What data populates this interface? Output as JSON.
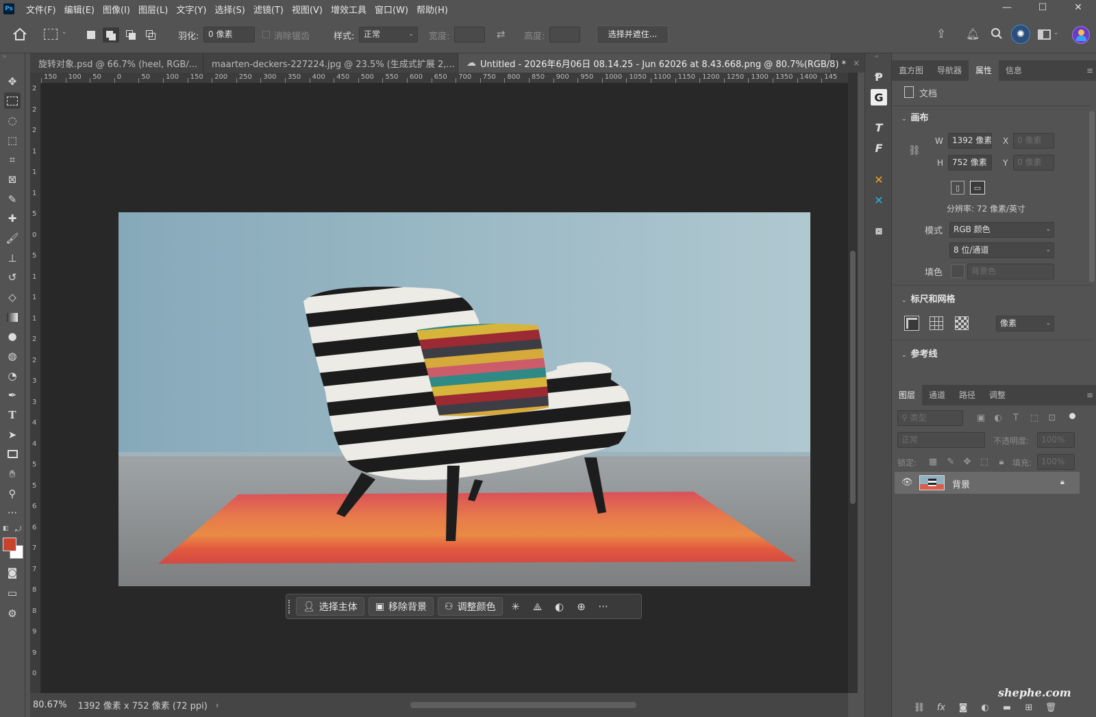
{
  "app": {
    "logo": "Ps"
  },
  "menu": [
    "文件(F)",
    "编辑(E)",
    "图像(I)",
    "图层(L)",
    "文字(Y)",
    "选择(S)",
    "滤镜(T)",
    "视图(V)",
    "增效工具",
    "窗口(W)",
    "帮助(H)"
  ],
  "window_controls": {
    "minimize": "—",
    "maximize": "☐",
    "close": "✕"
  },
  "options": {
    "feather_label": "羽化:",
    "feather_value": "0 像素",
    "antialias_label": "消除锯齿",
    "style_label": "样式:",
    "style_value": "正常",
    "width_label": "宽度:",
    "height_label": "高度:",
    "select_mask_button": "选择并遮住..."
  },
  "tabs": [
    {
      "label": "旋转对象.psd @ 66.7% (heel, RGB/...",
      "close": "×"
    },
    {
      "label": "maarten-deckers-227224.jpg @ 23.5% (生成式扩展 2,...",
      "close": "×"
    },
    {
      "label": "Untitled - 2026年6月06日 08.14.25 - Jun 62026 at 8.43.668.png @ 80.7%(RGB/8) *",
      "close": "×"
    }
  ],
  "ruler_top": [
    "150",
    "100",
    "50",
    "0",
    "50",
    "100",
    "150",
    "200",
    "250",
    "300",
    "350",
    "400",
    "450",
    "500",
    "550",
    "600",
    "650",
    "700",
    "750",
    "800",
    "850",
    "900",
    "950",
    "1000",
    "1050",
    "1100",
    "1150",
    "1200",
    "1250",
    "1300",
    "1350",
    "1400",
    "145"
  ],
  "ruler_left": [
    "2",
    "2",
    "2",
    "1",
    "1",
    "1",
    "5",
    "0",
    "5",
    "1",
    "1",
    "1",
    "2",
    "2",
    "3",
    "3",
    "4",
    "4",
    "5",
    "5",
    "6",
    "6",
    "7",
    "7",
    "8",
    "8",
    "9",
    "9",
    "0"
  ],
  "taskbar": {
    "select_subject": "选择主体",
    "remove_bg": "移除背景",
    "adjust_color": "调整颜色",
    "more": "···"
  },
  "status": {
    "zoom": "80.67%",
    "doc_info": "1392 像素 x 752 像素 (72 ppi)",
    "arrow": "›"
  },
  "right_panel": {
    "top_tabs": [
      "直方图",
      "导航器",
      "属性",
      "信息"
    ],
    "doc_label": "文档",
    "canvas_section": "画布",
    "w_label": "W",
    "w_value": "1392 像素",
    "h_label": "H",
    "h_value": "752 像素",
    "x_label": "X",
    "x_value": "0 像素",
    "y_label": "Y",
    "y_value": "0 像素",
    "resolution": "分辨率: 72 像素/英寸",
    "mode_label": "模式",
    "mode_value": "RGB 颜色",
    "depth_value": "8 位/通道",
    "fill_label": "填色",
    "fill_value": "背景色",
    "rulers_section": "标尺和网格",
    "unit_value": "像素",
    "guides_section": "参考线",
    "layer_tabs": [
      "图层",
      "通道",
      "路径",
      "调整"
    ],
    "filter_placeholder": "类型",
    "blend_mode": "正常",
    "opacity_label": "不透明度:",
    "opacity_value": "100%",
    "lock_label": "锁定:",
    "fill2_label": "填充:",
    "fill2_value": "100%",
    "layer_name": "背景"
  },
  "watermark": "shephe.com",
  "colors": {
    "accent": "#1473e6",
    "foreground": "#c8432c",
    "background": "#ffffff"
  }
}
